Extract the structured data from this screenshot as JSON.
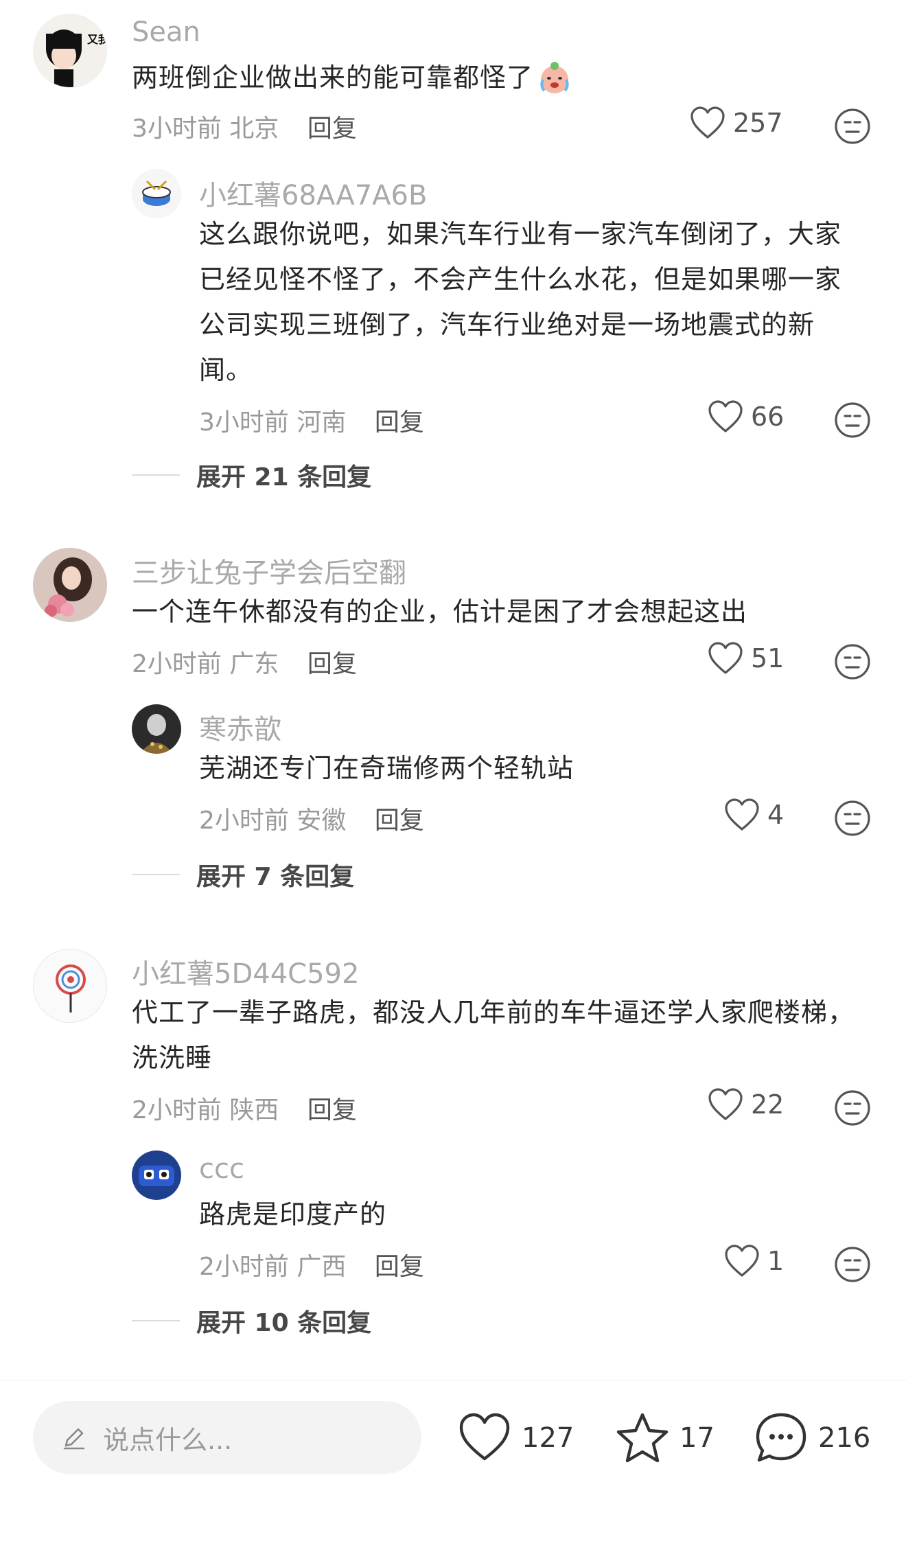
{
  "threads": [
    {
      "main": {
        "user": "Sean",
        "text": "两班倒企业做出来的能可靠都怪了",
        "time": "3小时前",
        "location": "北京",
        "reply": "回复",
        "likes": "257",
        "avatar_text": "又我??"
      },
      "sub": {
        "user": "小红薯68AA7A6B",
        "text": "这么跟你说吧，如果汽车行业有一家汽车倒闭了，大家已经见怪不怪了，不会产生什么水花，但是如果哪一家公司实现三班倒了，汽车行业绝对是一场地震式的新闻。",
        "time": "3小时前",
        "location": "河南",
        "reply": "回复",
        "likes": "66"
      },
      "expand": "展开 21 条回复"
    },
    {
      "main": {
        "user": "三步让兔子学会后空翻",
        "text": "一个连午休都没有的企业，估计是困了才会想起这出",
        "time": "2小时前",
        "location": "广东",
        "reply": "回复",
        "likes": "51"
      },
      "sub": {
        "user": "寒赤歆",
        "text": "芜湖还专门在奇瑞修两个轻轨站",
        "time": "2小时前",
        "location": "安徽",
        "reply": "回复",
        "likes": "4"
      },
      "expand": "展开 7 条回复"
    },
    {
      "main": {
        "user": "小红薯5D44C592",
        "text": "代工了一辈子路虎，都没人几年前的车牛逼还学人家爬楼梯，洗洗睡",
        "time": "2小时前",
        "location": "陕西",
        "reply": "回复",
        "likes": "22"
      },
      "sub": {
        "user": "ccc",
        "text": "路虎是印度产的",
        "time": "2小时前",
        "location": "广西",
        "reply": "回复",
        "likes": "1"
      },
      "expand": "展开 10 条回复"
    }
  ],
  "bottom_bar": {
    "input_placeholder": "说点什么...",
    "likes": "127",
    "favorites": "17",
    "comments": "216"
  },
  "icons": {
    "like": "heart-outline-icon",
    "emoji": "neutral-face-icon",
    "edit": "pencil-icon",
    "favorite": "star-outline-icon",
    "comment": "chat-bubble-icon"
  },
  "colors": {
    "username": "#a9a9a9",
    "text": "#262626",
    "meta": "#9a9a9a",
    "input_bg": "#f3f3f3"
  }
}
